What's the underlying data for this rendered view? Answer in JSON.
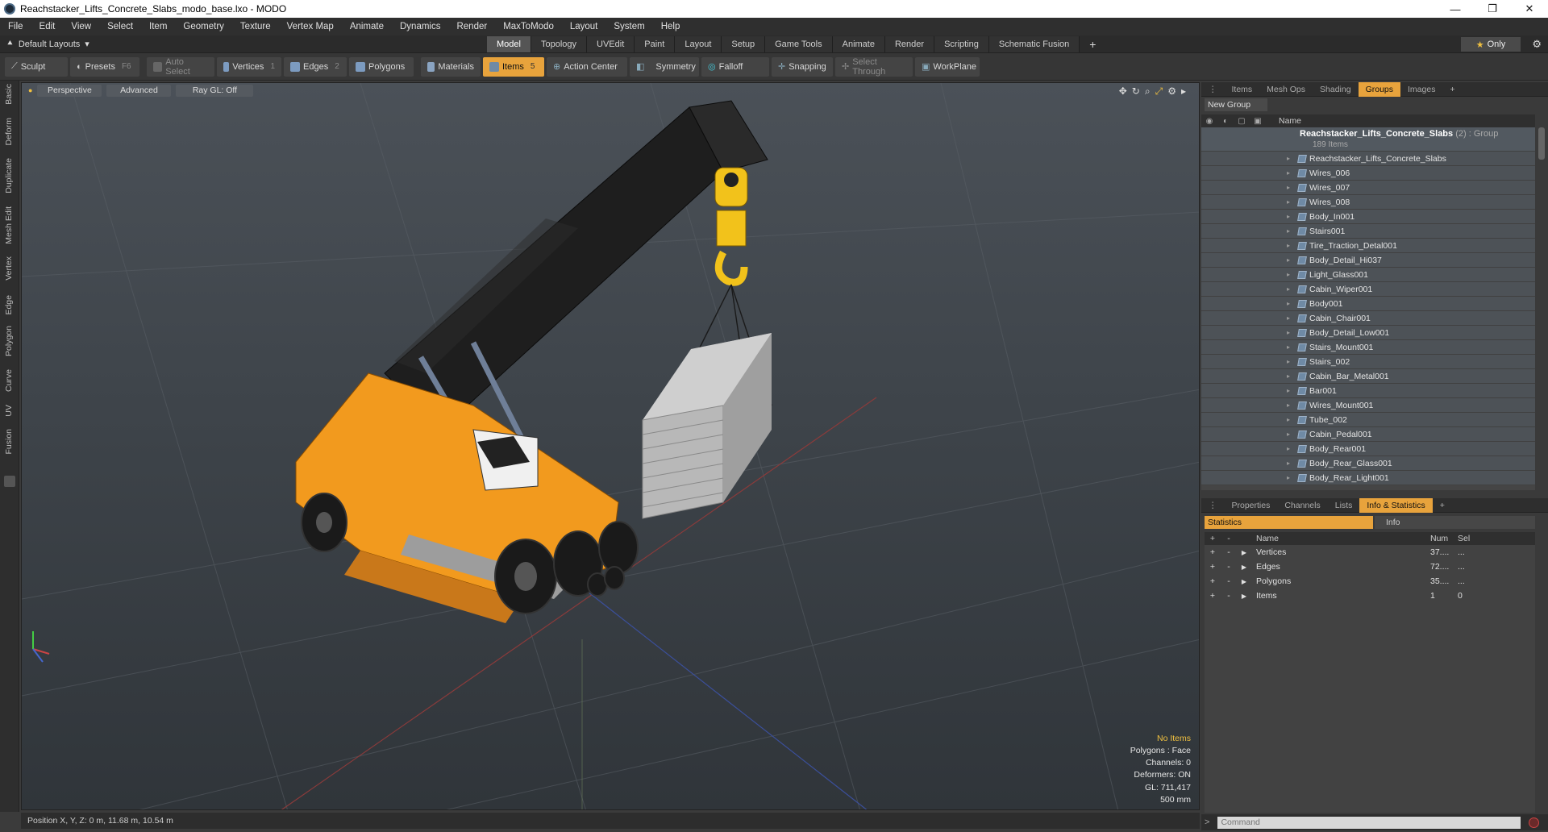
{
  "window": {
    "title": "Reachstacker_Lifts_Concrete_Slabs_modo_base.lxo - MODO",
    "minimize": "—",
    "maximize": "❐",
    "close": "✕"
  },
  "menu": [
    "File",
    "Edit",
    "View",
    "Select",
    "Item",
    "Geometry",
    "Texture",
    "Vertex Map",
    "Animate",
    "Dynamics",
    "Render",
    "MaxToModo",
    "Layout",
    "System",
    "Help"
  ],
  "layout": {
    "selector": "Default Layouts",
    "tabs": [
      "Model",
      "Topology",
      "UVEdit",
      "Paint",
      "Layout",
      "Setup",
      "Game Tools",
      "Animate",
      "Render",
      "Scripting",
      "Schematic Fusion"
    ],
    "active_tab": "Model",
    "add_tab": "+",
    "only_label": "Only"
  },
  "toolbar": {
    "sculpt": "Sculpt",
    "presets": "Presets",
    "presets_key": "F6",
    "auto_select": "Auto Select",
    "vertices": "Vertices",
    "vertices_key": "1",
    "edges": "Edges",
    "edges_key": "2",
    "polygons": "Polygons",
    "materials": "Materials",
    "items": "Items",
    "items_key": "5",
    "action_center": "Action Center",
    "symmetry": "Symmetry",
    "falloff": "Falloff",
    "snapping": "Snapping",
    "select_through": "Select Through",
    "workplane": "WorkPlane"
  },
  "left_tabs": [
    "Basic",
    "Deform",
    "Duplicate",
    "Mesh Edit",
    "Vertex",
    "Edge",
    "Polygon",
    "Curve",
    "UV",
    "Fusion"
  ],
  "viewport": {
    "view": "Perspective",
    "shading": "Advanced",
    "raygl": "Ray GL: Off",
    "info": {
      "selection": "No Items",
      "polygons": "Polygons : Face",
      "channels": "Channels: 0",
      "deformers": "Deformers: ON",
      "gl": "GL: 711,417",
      "scale": "500 mm"
    }
  },
  "status": {
    "position": "Position X, Y, Z:  0 m, 11.68 m, 10.54 m"
  },
  "items_panel": {
    "tabs": [
      "Items",
      "Mesh Ops",
      "Shading",
      "Groups",
      "Images"
    ],
    "active_tab": "Groups",
    "new_group": "New Group",
    "column_name": "Name",
    "group": {
      "name": "Reachstacker_Lifts_Concrete_Slabs",
      "tag": "(2) : Group",
      "count": "189 Items"
    },
    "items": [
      "Reachstacker_Lifts_Concrete_Slabs",
      "Wires_006",
      "Wires_007",
      "Wires_008",
      "Body_In001",
      "Stairs001",
      "Tire_Traction_Detal001",
      "Body_Detail_Hi037",
      "Light_Glass001",
      "Cabin_Wiper001",
      "Body001",
      "Cabin_Chair001",
      "Body_Detail_Low001",
      "Stairs_Mount001",
      "Stairs_002",
      "Cabin_Bar_Metal001",
      "Bar001",
      "Wires_Mount001",
      "Tube_002",
      "Cabin_Pedal001",
      "Body_Rear001",
      "Body_Rear_Glass001",
      "Body_Rear_Light001"
    ]
  },
  "stats_panel": {
    "tabs": [
      "Properties",
      "Channels",
      "Lists",
      "Info & Statistics"
    ],
    "active_tab": "Info & Statistics",
    "sub_tabs": [
      "Statistics",
      "Info"
    ],
    "columns": {
      "name": "Name",
      "num": "Num",
      "sel": "Sel"
    },
    "rows": [
      {
        "name": "Vertices",
        "num": "37....",
        "sel": "..."
      },
      {
        "name": "Edges",
        "num": "72....",
        "sel": "..."
      },
      {
        "name": "Polygons",
        "num": "35....",
        "sel": "..."
      },
      {
        "name": "Items",
        "num": "1",
        "sel": "0"
      }
    ]
  },
  "command": {
    "prompt": ">",
    "placeholder": "Command"
  },
  "colors": {
    "accent": "#e8a33c",
    "machine_orange": "#f29a1e",
    "boom_black": "#1e1e1e",
    "hook_yellow": "#f2c21b",
    "concrete": "#bcbcbc"
  }
}
